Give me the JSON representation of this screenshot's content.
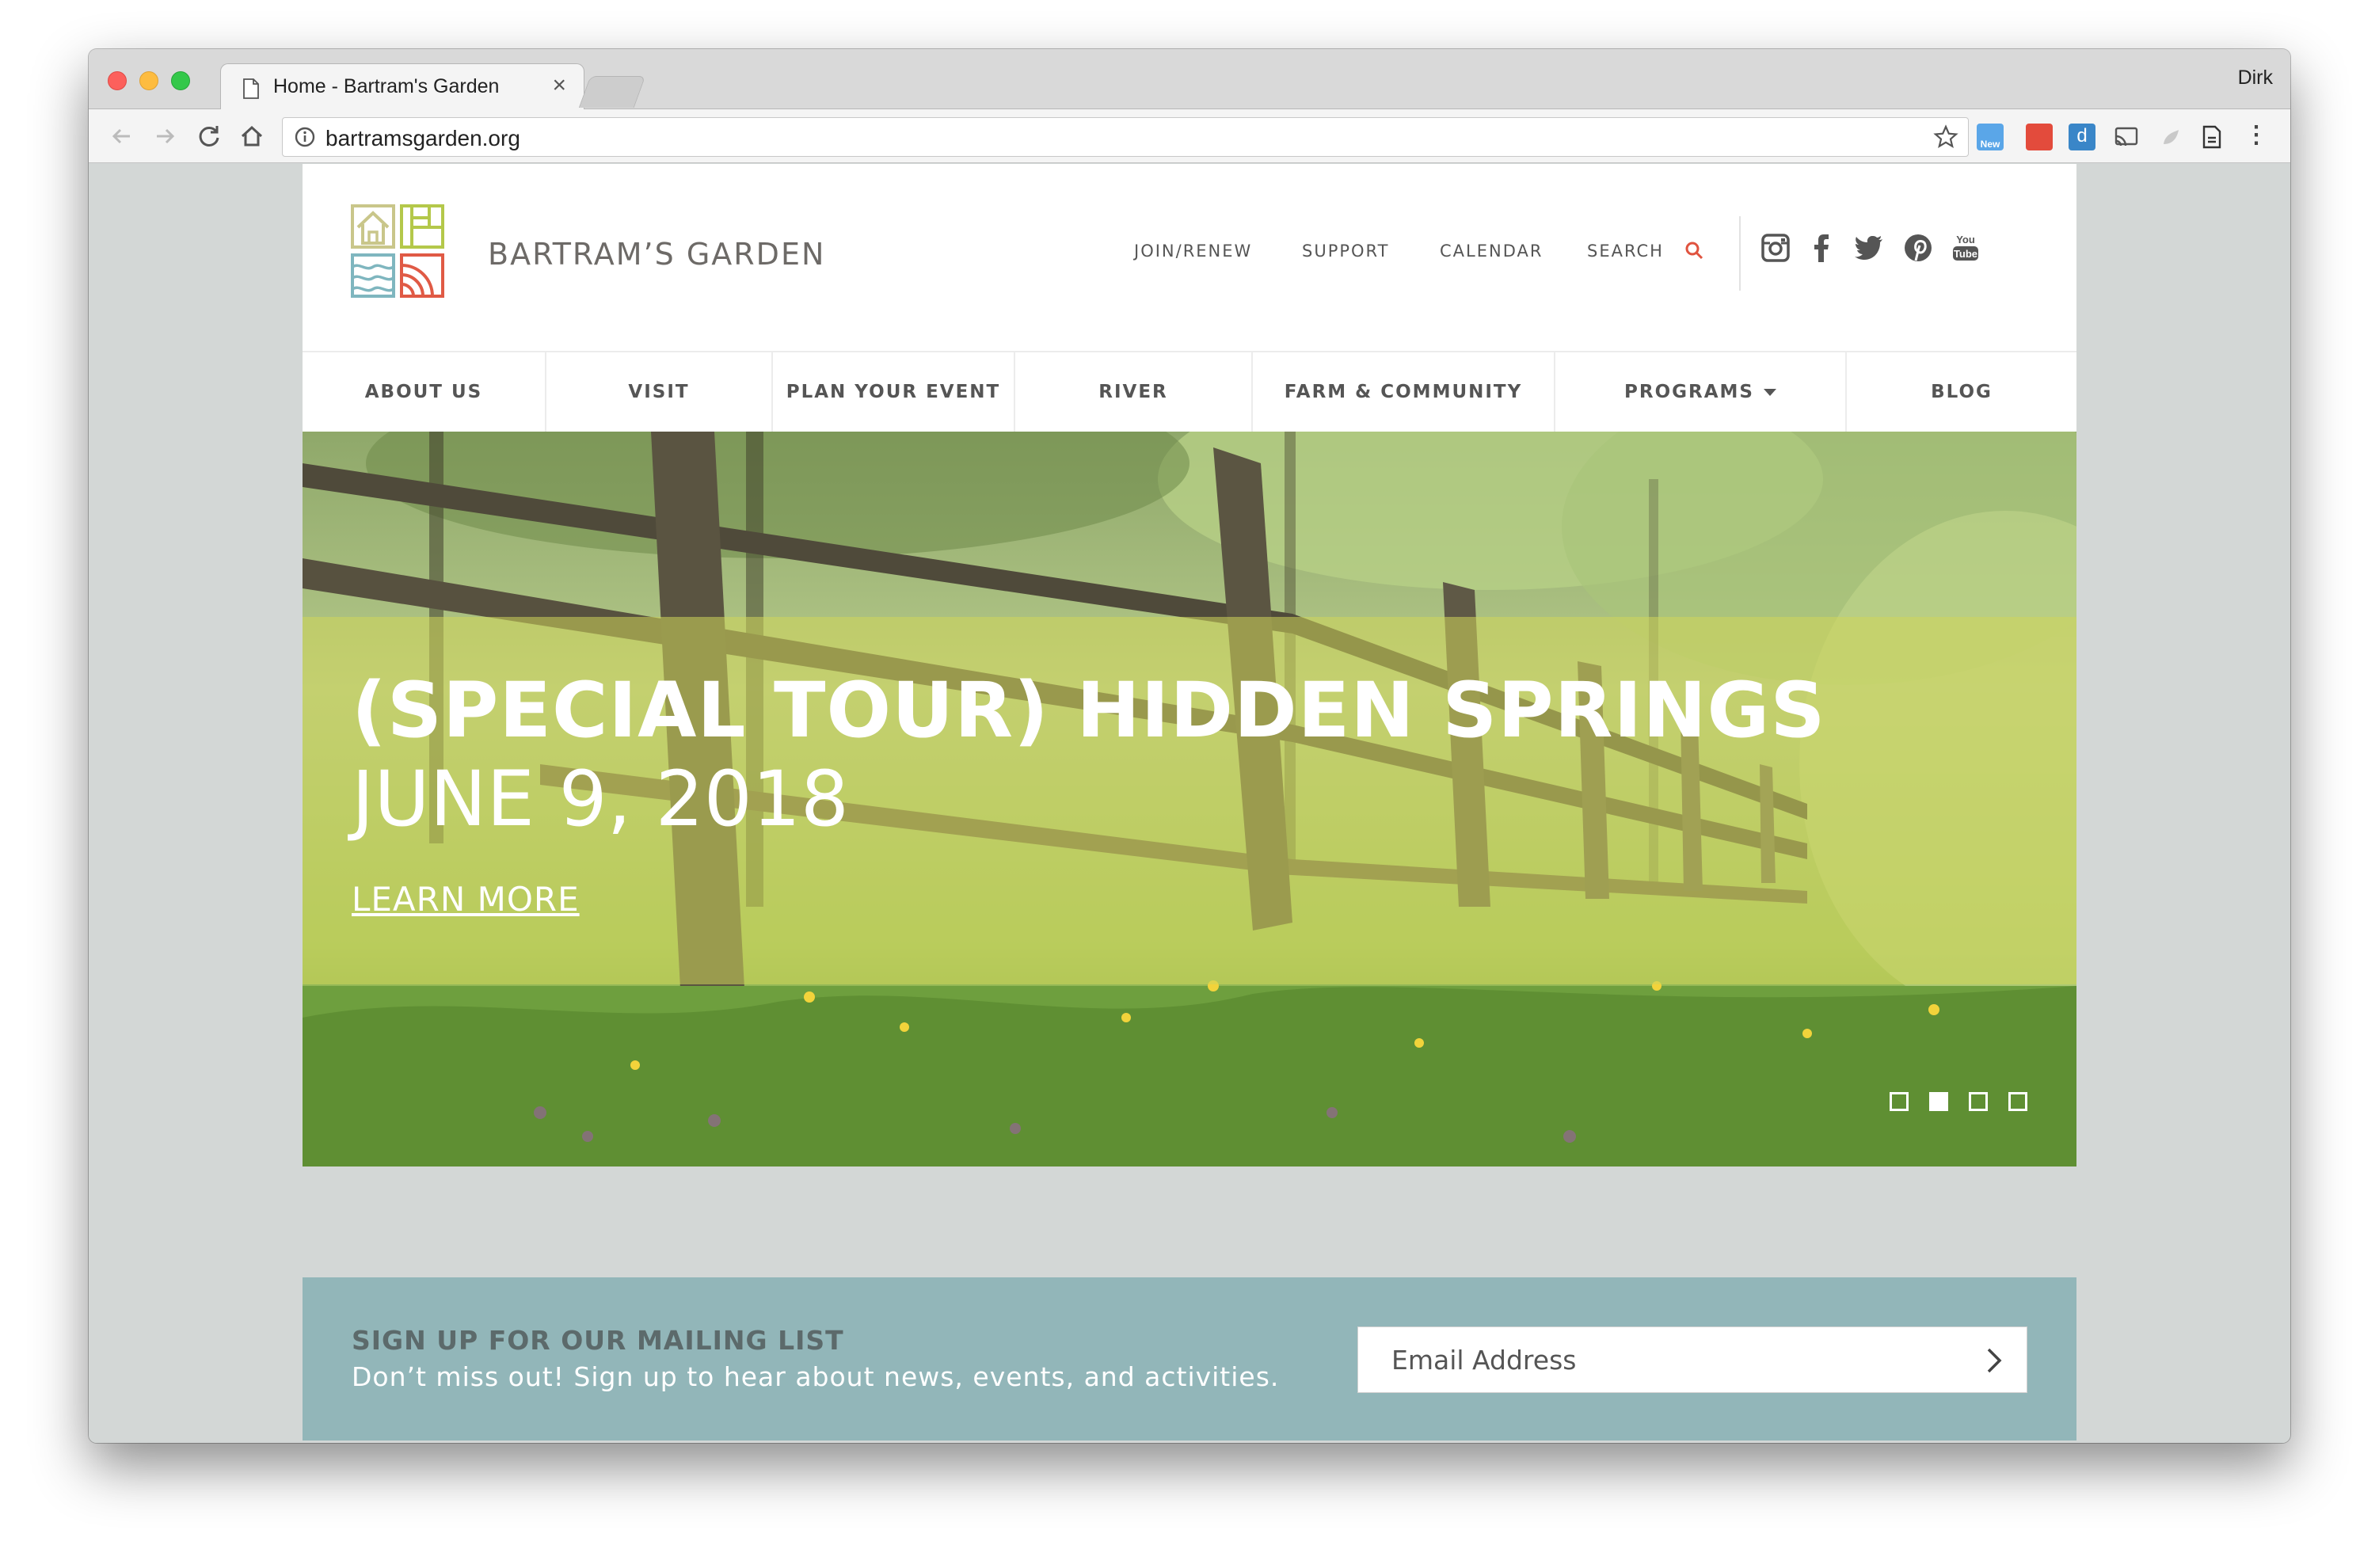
{
  "browser": {
    "tab_title": "Home - Bartram's Garden",
    "tab_close": "×",
    "profile_name": "Dirk",
    "url": "bartramsgarden.org",
    "ext_new_label": "New",
    "ext_d_label": "d",
    "menu_glyph": "⋮"
  },
  "site": {
    "logo_text": "BARTRAM’S GARDEN",
    "utility_nav": {
      "join": "JOIN/RENEW",
      "support": "SUPPORT",
      "calendar": "CALENDAR",
      "search": "SEARCH"
    },
    "social_icons": [
      "instagram-icon",
      "facebook-icon",
      "twitter-icon",
      "pinterest-icon",
      "youtube-icon"
    ],
    "main_nav": [
      {
        "label": "ABOUT US"
      },
      {
        "label": "VISIT"
      },
      {
        "label": "PLAN YOUR EVENT"
      },
      {
        "label": "RIVER"
      },
      {
        "label": "FARM & COMMUNITY"
      },
      {
        "label": "PROGRAMS"
      },
      {
        "label": "BLOG"
      }
    ],
    "hero": {
      "title": "(SPECIAL TOUR) HIDDEN SPRINGS",
      "date": "JUNE 9, 2018",
      "link": "LEARN MORE",
      "slides": 4,
      "active_slide": 2
    },
    "mailing": {
      "title": "SIGN UP FOR OUR MAILING LIST",
      "subtitle": "Don’t miss out! Sign up to hear about news, events, and activities.",
      "placeholder": "Email Address"
    }
  },
  "colors": {
    "accent_search": "#e0533f",
    "mailing_bg": "#92b6b9",
    "page_bg": "#d3d7d6",
    "hero_band": "#d0d65a"
  }
}
